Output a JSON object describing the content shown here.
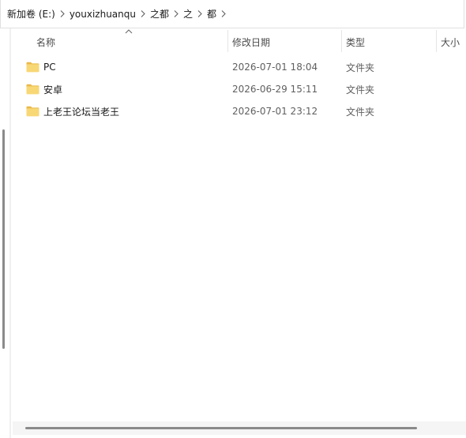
{
  "breadcrumb": {
    "items": [
      {
        "label": "新加卷 (E:)"
      },
      {
        "label": "youxizhuanqu"
      },
      {
        "label": "之都"
      },
      {
        "label": "之"
      },
      {
        "label": "都"
      }
    ]
  },
  "columns": {
    "name": "名称",
    "date_modified": "修改日期",
    "type": "类型",
    "size": "大小"
  },
  "sort": {
    "column": "name",
    "direction": "ascending"
  },
  "files": [
    {
      "name": "PC",
      "date_modified": "2026-07-01 18:04",
      "type": "文件夹",
      "icon": "folder-icon"
    },
    {
      "name": "安卓",
      "date_modified": "2026-06-29 15:11",
      "type": "文件夹",
      "icon": "folder-icon"
    },
    {
      "name": "上老王论坛当老王",
      "date_modified": "2026-07-01 23:12",
      "type": "文件夹",
      "icon": "folder-icon"
    }
  ],
  "colors": {
    "folder_body": "#F8D775",
    "folder_tab": "#E9B94A",
    "text_primary": "#1a1a1a",
    "text_secondary": "#5f5f5f"
  }
}
